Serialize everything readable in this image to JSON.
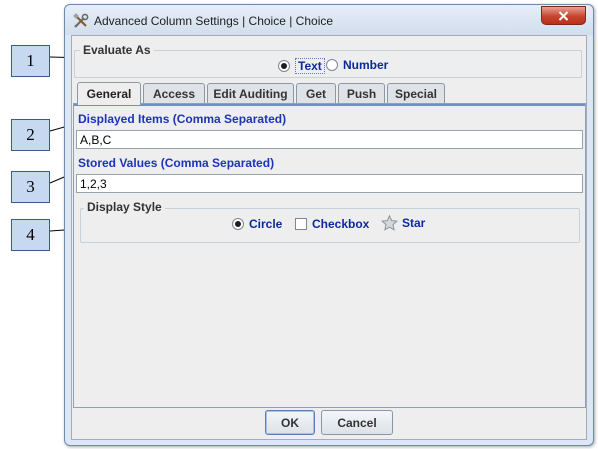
{
  "callouts": [
    "1",
    "2",
    "3",
    "4"
  ],
  "window": {
    "title": "Advanced Column Settings | Choice | Choice",
    "close_icon": "close-x-icon",
    "title_icon": "tools-icon"
  },
  "evaluate_as": {
    "legend": "Evaluate As",
    "options": [
      {
        "label": "Text",
        "selected": true
      },
      {
        "label": "Number",
        "selected": false
      }
    ]
  },
  "tabs": [
    {
      "label": "General",
      "active": true
    },
    {
      "label": "Access",
      "active": false
    },
    {
      "label": "Edit Auditing",
      "active": false
    },
    {
      "label": "Get",
      "active": false
    },
    {
      "label": "Push",
      "active": false
    },
    {
      "label": "Special",
      "active": false
    }
  ],
  "general": {
    "displayed_items_label": "Displayed Items (Comma Separated)",
    "displayed_items_value": "A,B,C",
    "stored_values_label": "Stored Values (Comma Separated)",
    "stored_values_value": "1,2,3",
    "display_style": {
      "legend": "Display Style",
      "options": [
        {
          "label": "Circle",
          "kind": "radio",
          "selected": true
        },
        {
          "label": "Checkbox",
          "kind": "checkbox",
          "selected": false
        },
        {
          "label": "Star",
          "kind": "star",
          "selected": false
        }
      ]
    }
  },
  "buttons": {
    "ok": "OK",
    "cancel": "Cancel"
  },
  "colors": {
    "accent_text": "#1b34b8",
    "callout_fill": "#c6d9f1",
    "close_button": "#c7442e"
  }
}
